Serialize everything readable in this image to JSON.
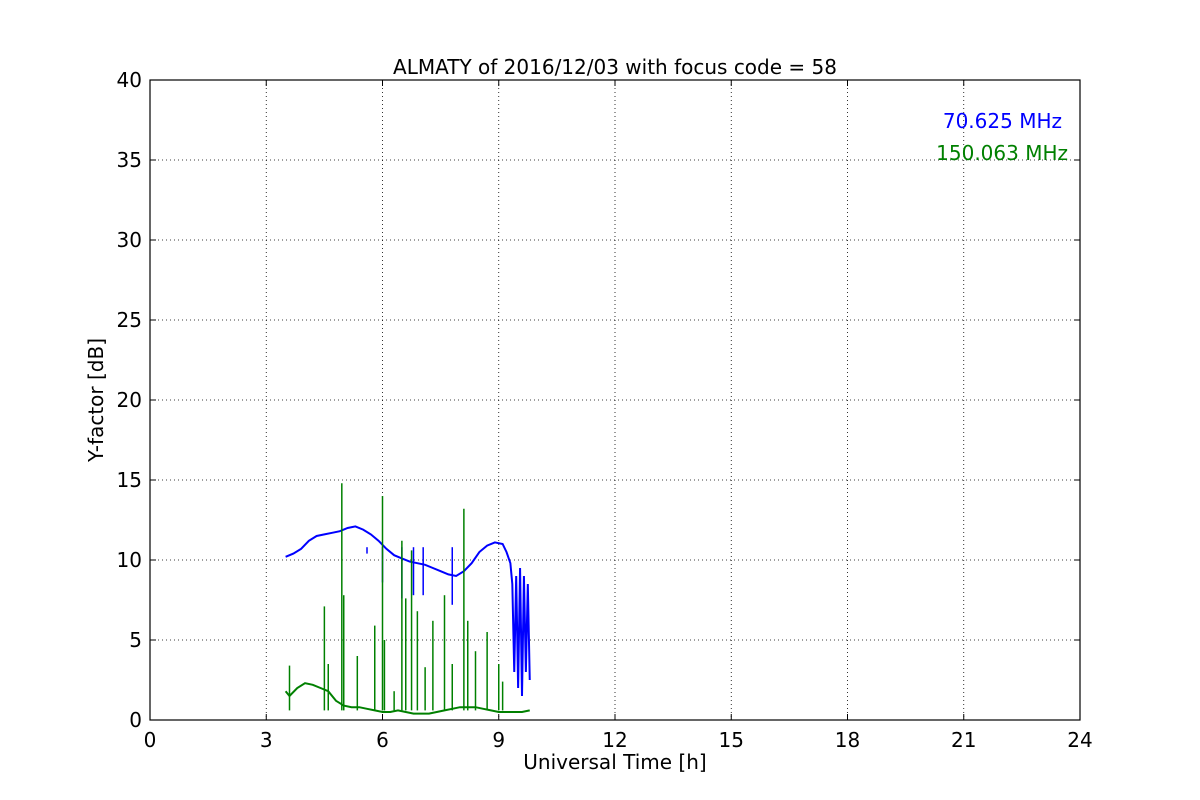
{
  "chart_data": {
    "type": "line",
    "title": "ALMATY of 2016/12/03 with focus code = 58",
    "xlabel": "Universal Time [h]",
    "ylabel": "Y-factor [dB]",
    "xlim": [
      0,
      24
    ],
    "ylim": [
      0,
      40
    ],
    "xticks": [
      0,
      3,
      6,
      9,
      12,
      15,
      18,
      21,
      24
    ],
    "yticks": [
      0,
      5,
      10,
      15,
      20,
      25,
      30,
      35,
      40
    ],
    "grid": true,
    "legend_position": "top-right",
    "series": [
      {
        "name": "70.625 MHz",
        "color": "#0000ff",
        "x": [
          3.5,
          3.7,
          3.9,
          4.1,
          4.3,
          4.5,
          4.7,
          4.9,
          5.1,
          5.3,
          5.5,
          5.7,
          5.9,
          6.1,
          6.3,
          6.5,
          6.7,
          6.9,
          7.1,
          7.3,
          7.5,
          7.7,
          7.9,
          8.1,
          8.3,
          8.5,
          8.7,
          8.9,
          9.1,
          9.2,
          9.3,
          9.35,
          9.4,
          9.45,
          9.5,
          9.55,
          9.6,
          9.65,
          9.7,
          9.75,
          9.8
        ],
        "y": [
          10.2,
          10.4,
          10.7,
          11.2,
          11.5,
          11.6,
          11.7,
          11.8,
          12.0,
          12.1,
          11.9,
          11.6,
          11.2,
          10.7,
          10.3,
          10.1,
          9.9,
          9.8,
          9.7,
          9.5,
          9.3,
          9.1,
          9.0,
          9.3,
          9.8,
          10.5,
          10.9,
          11.1,
          11.0,
          10.5,
          9.8,
          8.5,
          3.0,
          9.0,
          2.0,
          9.5,
          1.5,
          9.0,
          3.0,
          8.5,
          2.5
        ]
      },
      {
        "name": "150.063 MHz",
        "color": "#008000",
        "x": [
          3.5,
          3.6,
          3.8,
          4.0,
          4.2,
          4.4,
          4.6,
          4.8,
          5.0,
          5.2,
          5.4,
          5.6,
          5.8,
          6.0,
          6.2,
          6.4,
          6.6,
          6.8,
          7.0,
          7.2,
          7.4,
          7.6,
          7.8,
          8.0,
          8.2,
          8.4,
          8.6,
          8.8,
          9.0,
          9.2,
          9.4,
          9.6,
          9.8
        ],
        "y": [
          1.8,
          1.5,
          2.0,
          2.3,
          2.2,
          2.0,
          1.8,
          1.2,
          0.9,
          0.8,
          0.8,
          0.7,
          0.6,
          0.5,
          0.5,
          0.6,
          0.5,
          0.4,
          0.4,
          0.4,
          0.5,
          0.6,
          0.7,
          0.8,
          0.8,
          0.8,
          0.7,
          0.6,
          0.5,
          0.5,
          0.5,
          0.5,
          0.6
        ]
      }
    ],
    "spikes_150": [
      [
        3.6,
        3.4
      ],
      [
        4.5,
        7.1
      ],
      [
        4.6,
        3.5
      ],
      [
        4.95,
        14.8
      ],
      [
        5.0,
        7.8
      ],
      [
        5.35,
        4.0
      ],
      [
        5.8,
        5.9
      ],
      [
        6.0,
        14.0
      ],
      [
        6.05,
        5.0
      ],
      [
        6.3,
        1.8
      ],
      [
        6.5,
        11.2
      ],
      [
        6.6,
        7.6
      ],
      [
        6.75,
        10.6
      ],
      [
        6.9,
        6.8
      ],
      [
        7.1,
        3.3
      ],
      [
        7.3,
        6.2
      ],
      [
        7.6,
        7.8
      ],
      [
        7.8,
        3.5
      ],
      [
        8.1,
        13.2
      ],
      [
        8.2,
        6.2
      ],
      [
        8.4,
        4.3
      ],
      [
        8.7,
        5.5
      ],
      [
        9.0,
        3.5
      ],
      [
        9.1,
        2.4
      ]
    ],
    "dips_70": [
      [
        5.6,
        10.4
      ],
      [
        6.0,
        8.6
      ],
      [
        6.5,
        7.6
      ],
      [
        6.8,
        7.8
      ],
      [
        7.05,
        7.8
      ],
      [
        7.8,
        7.2
      ]
    ]
  }
}
